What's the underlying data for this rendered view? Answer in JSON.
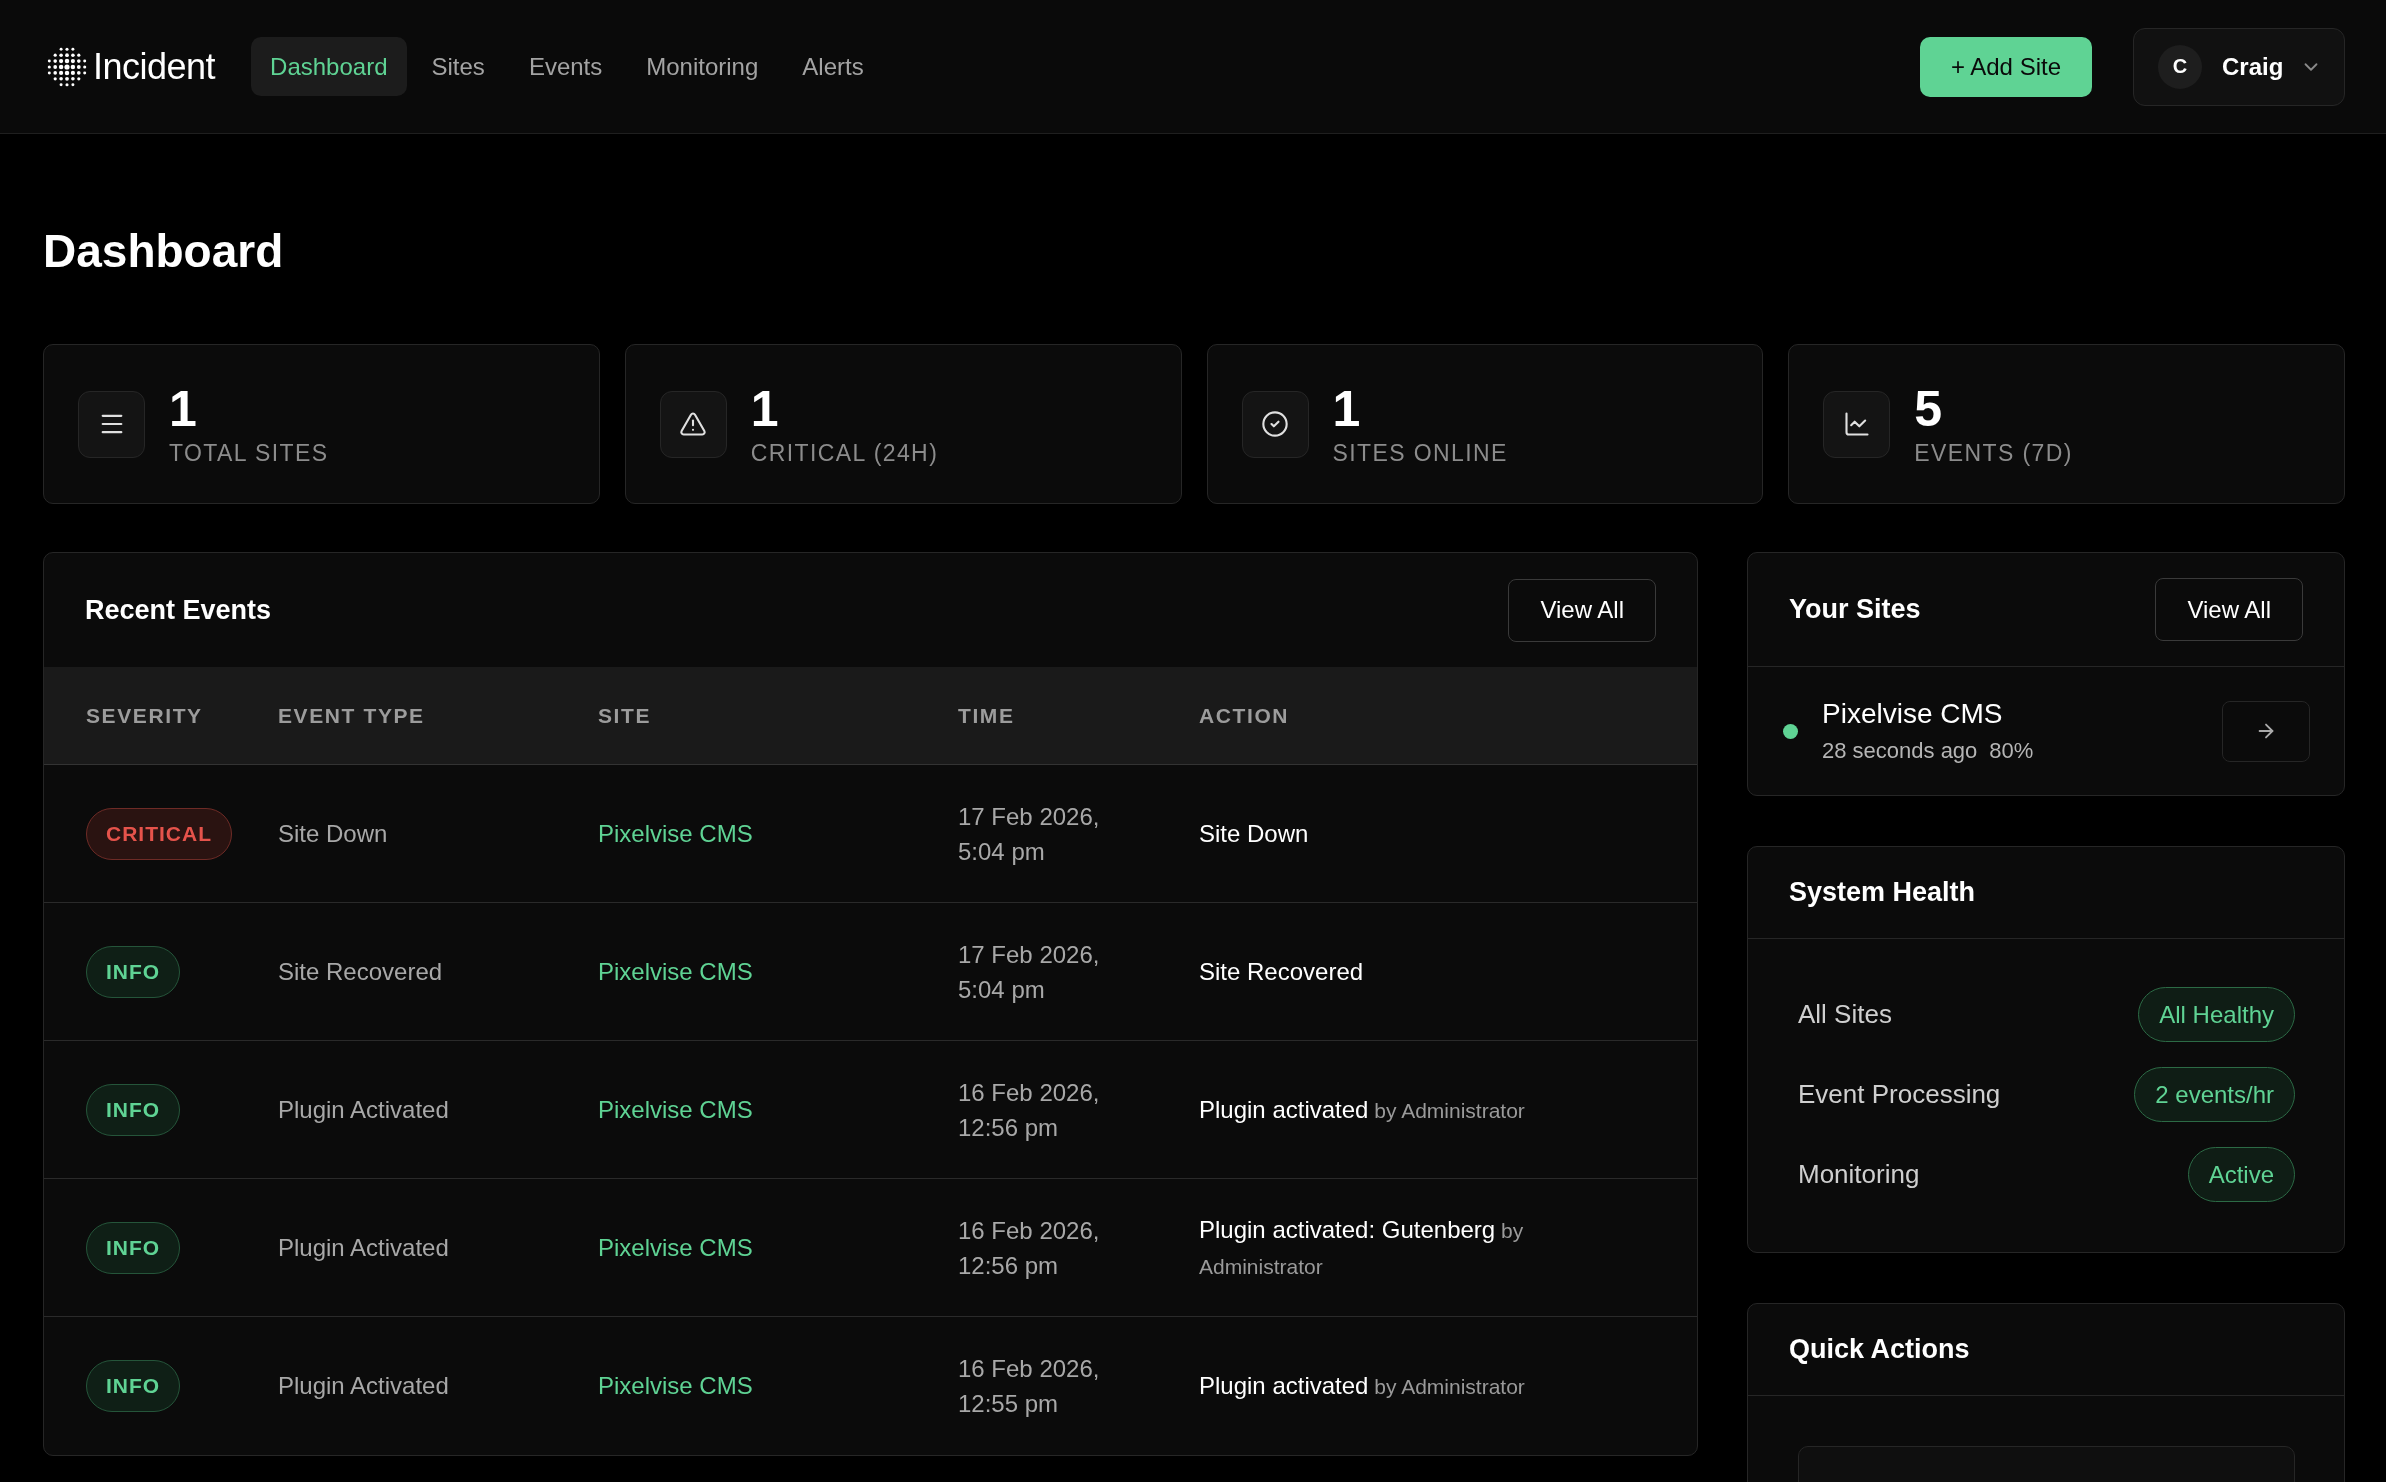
{
  "header": {
    "logo": "Incident",
    "nav": [
      {
        "label": "Dashboard",
        "selected": true
      },
      {
        "label": "Sites",
        "selected": false
      },
      {
        "label": "Events",
        "selected": false
      },
      {
        "label": "Monitoring",
        "selected": false
      },
      {
        "label": "Alerts",
        "selected": false
      }
    ],
    "add_button": "+ Add Site",
    "user": {
      "initial": "C",
      "name": "Craig"
    }
  },
  "page_title": "Dashboard",
  "stats": [
    {
      "kind": "list",
      "value": "1",
      "label": "TOTAL SITES"
    },
    {
      "kind": "warning",
      "value": "1",
      "label": "CRITICAL (24H)"
    },
    {
      "kind": "check",
      "value": "1",
      "label": "SITES ONLINE"
    },
    {
      "kind": "chart",
      "value": "5",
      "label": "EVENTS (7D)"
    }
  ],
  "recent_events": {
    "title": "Recent Events",
    "view_all": "View All",
    "columns": [
      "SEVERITY",
      "EVENT TYPE",
      "SITE",
      "TIME",
      "ACTION"
    ],
    "rows": [
      {
        "severity": {
          "label": "CRITICAL",
          "kind": "critical"
        },
        "event_type": "Site Down",
        "site": "Pixelvise CMS",
        "time": "17 Feb 2026, 5:04 pm",
        "action": "Site Down"
      },
      {
        "severity": {
          "label": "INFO",
          "kind": "info"
        },
        "event_type": "Site Recovered",
        "site": "Pixelvise CMS",
        "time": "17 Feb 2026, 5:04 pm",
        "action": "Site Recovered"
      },
      {
        "severity": {
          "label": "INFO",
          "kind": "info"
        },
        "event_type": "Plugin Activated",
        "site": "Pixelvise CMS",
        "time": "16 Feb 2026, 12:56 pm",
        "action": "Plugin activated",
        "actor": "by Administrator"
      },
      {
        "severity": {
          "label": "INFO",
          "kind": "info"
        },
        "event_type": "Plugin Activated",
        "site": "Pixelvise CMS",
        "time": "16 Feb 2026, 12:56 pm",
        "action": "Plugin activated: Gutenberg",
        "actor": "by Administrator"
      },
      {
        "severity": {
          "label": "INFO",
          "kind": "info"
        },
        "event_type": "Plugin Activated",
        "site": "Pixelvise CMS",
        "time": "16 Feb 2026, 12:55 pm",
        "action": "Plugin activated",
        "actor": "by Administrator"
      }
    ]
  },
  "your_sites": {
    "title": "Your Sites",
    "view_all": "View All",
    "items": [
      {
        "name": "Pixelvise CMS",
        "online": true,
        "meta": [
          "28 seconds ago",
          "80%"
        ]
      }
    ]
  },
  "system_health": {
    "title": "System Health",
    "rows": [
      {
        "label": "All Sites",
        "value": "All Healthy",
        "kind": "ok"
      },
      {
        "label": "Event Processing",
        "value": "2 events/hr",
        "kind": "ok"
      },
      {
        "label": "Monitoring",
        "value": "Active",
        "kind": "ok"
      }
    ]
  },
  "quick_actions": {
    "title": "Quick Actions"
  }
}
